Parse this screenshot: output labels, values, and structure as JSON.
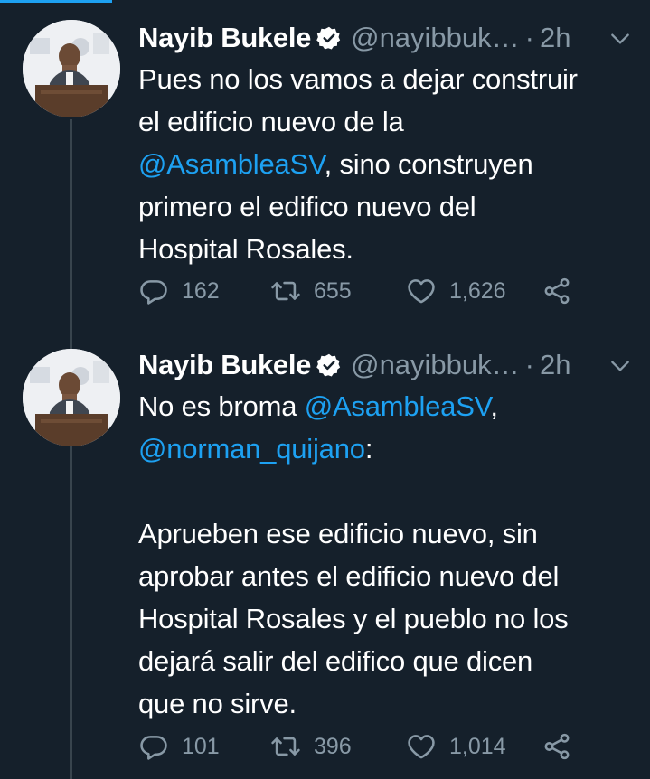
{
  "colors": {
    "background": "#15202b",
    "text": "#ffffff",
    "secondary": "#8899a6",
    "accent": "#1da1f2",
    "thread_line": "#38444d"
  },
  "tweets": [
    {
      "author_name": "Nayib Bukele",
      "handle": "@nayibbuk…",
      "separator": "·",
      "time": "2h",
      "verified": true,
      "lines": [
        [
          {
            "text": "Pues no los vamos a dejar construir",
            "type": "text"
          }
        ],
        [
          {
            "text": "el edificio nuevo de la",
            "type": "text"
          }
        ],
        [
          {
            "text": "@AsambleaSV",
            "type": "mention"
          },
          {
            "text": ", sino construyen",
            "type": "text"
          }
        ],
        [
          {
            "text": "primero el edifico nuevo del",
            "type": "text"
          }
        ],
        [
          {
            "text": "Hospital Rosales.",
            "type": "text"
          }
        ]
      ],
      "replies": "162",
      "retweets": "655",
      "likes": "1,626"
    },
    {
      "author_name": "Nayib Bukele",
      "handle": "@nayibbuk…",
      "separator": "·",
      "time": "2h",
      "verified": true,
      "lines": [
        [
          {
            "text": "No es broma ",
            "type": "text"
          },
          {
            "text": "@AsambleaSV",
            "type": "mention"
          },
          {
            "text": ",",
            "type": "text"
          }
        ],
        [
          {
            "text": "@norman_quijano",
            "type": "mention"
          },
          {
            "text": ":",
            "type": "text"
          }
        ],
        [],
        [
          {
            "text": "Aprueben ese edificio nuevo, sin",
            "type": "text"
          }
        ],
        [
          {
            "text": "aprobar antes el edificio nuevo del",
            "type": "text"
          }
        ],
        [
          {
            "text": "Hospital Rosales y el pueblo no los",
            "type": "text"
          }
        ],
        [
          {
            "text": "dejará salir del edifico que dicen",
            "type": "text"
          }
        ],
        [
          {
            "text": "que no sirve.",
            "type": "text"
          }
        ]
      ],
      "replies": "101",
      "retweets": "396",
      "likes": "1,014"
    }
  ],
  "icons": {
    "verified": "verified-badge-icon",
    "menu": "chevron-down-icon",
    "reply": "reply-icon",
    "retweet": "retweet-icon",
    "like": "like-icon",
    "share": "share-icon"
  }
}
